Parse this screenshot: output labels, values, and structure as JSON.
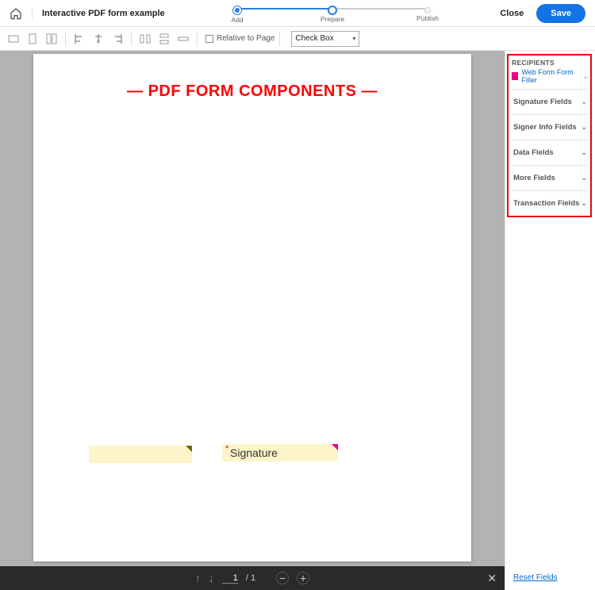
{
  "header": {
    "doc_title": "Interactive PDF form example",
    "steps": [
      {
        "label": "Add"
      },
      {
        "label": "Prepare"
      },
      {
        "label": "Publish"
      }
    ],
    "close_label": "Close",
    "save_label": "Save"
  },
  "toolbar": {
    "relative_label": "Relative to Page",
    "field_type_selected": "Check Box"
  },
  "page": {
    "heading": "— PDF FORM COMPONENTS —",
    "signature_placeholder": "Signature"
  },
  "pagebar": {
    "current": "1",
    "total": "/ 1"
  },
  "sidepanel": {
    "recipients_heading": "RECIPIENTS",
    "recipient_name": "Web Form Form Filler",
    "categories": [
      {
        "label": "Signature Fields"
      },
      {
        "label": "Signer Info Fields"
      },
      {
        "label": "Data Fields"
      },
      {
        "label": "More Fields"
      },
      {
        "label": "Transaction Fields"
      }
    ],
    "reset_label": "Reset Fields"
  }
}
